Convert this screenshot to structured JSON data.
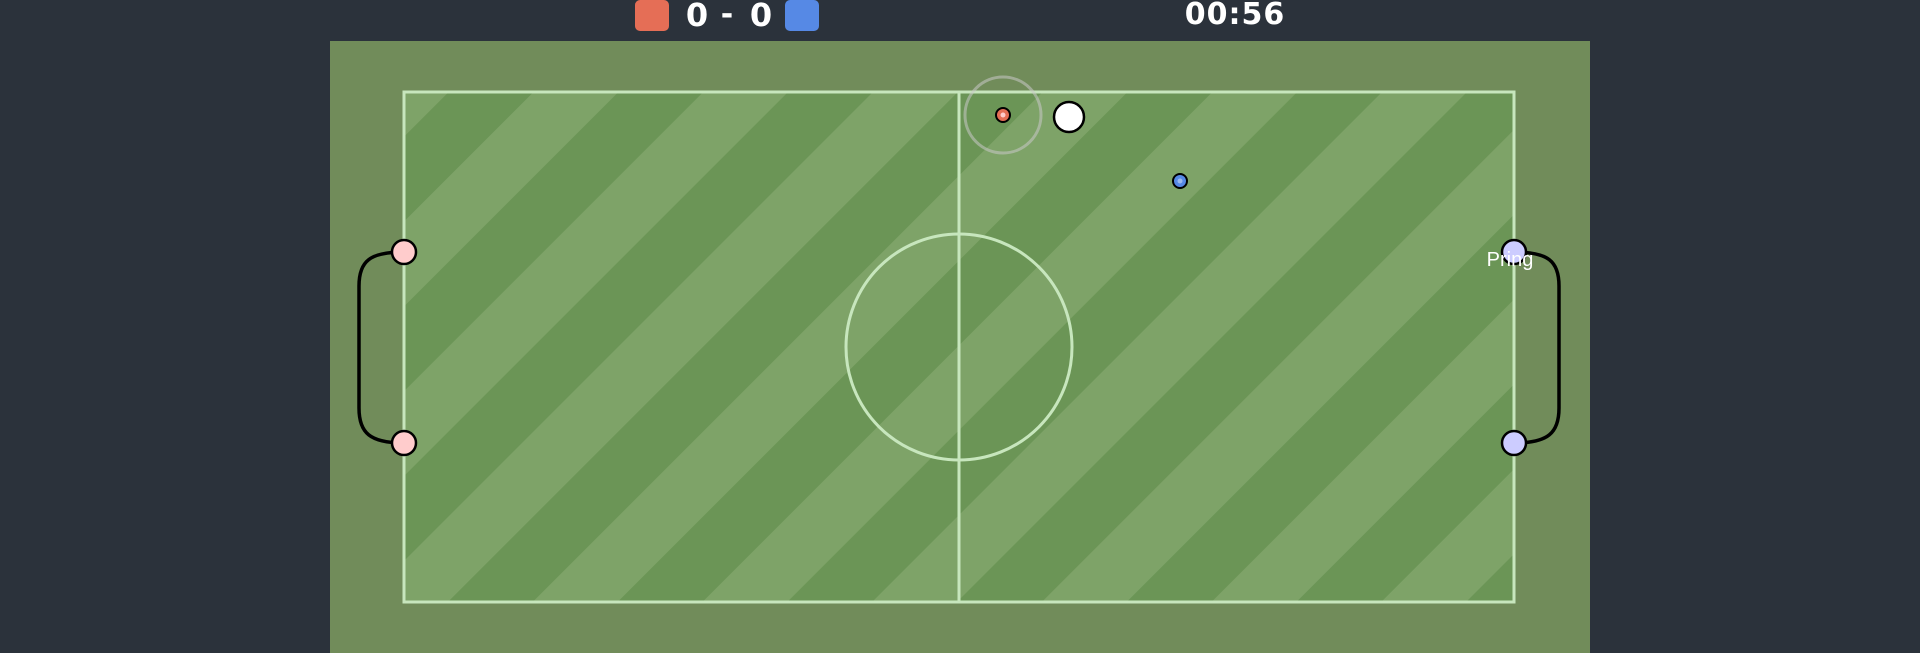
{
  "scoreboard": {
    "red_score": "0",
    "separator": "-",
    "blue_score": "0",
    "timer": "00:56"
  },
  "colors": {
    "background": "#2b323b",
    "red_team": "#e56e56",
    "blue_team": "#5689e5",
    "field_border": "#718c5a",
    "grass_dark": "#6b9556",
    "grass_light": "#7ea368",
    "lines": "#c7e6bd",
    "red_goal_post": "#ffcccc",
    "blue_goal_post": "#ccccff",
    "ball": "#ffffff"
  },
  "players": [
    {
      "team": "red",
      "name": ""
    },
    {
      "team": "blue",
      "name": "Pring"
    }
  ]
}
